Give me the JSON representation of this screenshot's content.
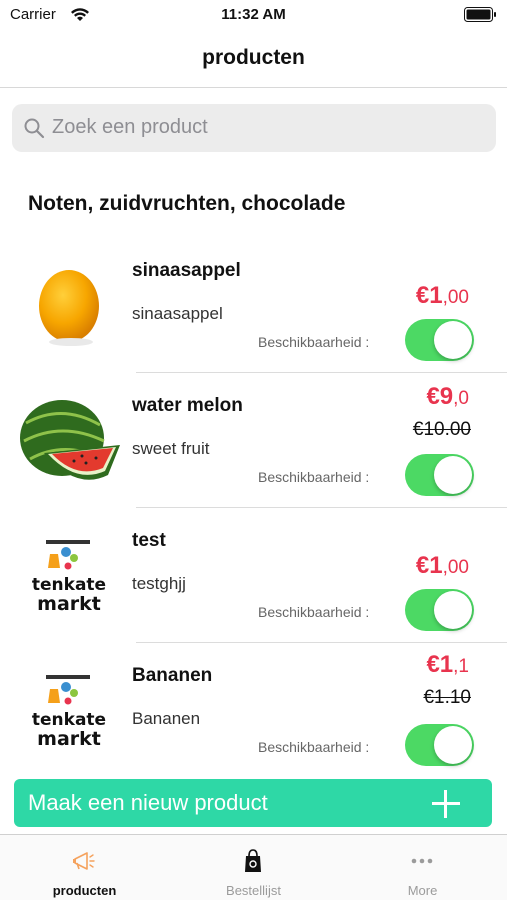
{
  "status_bar": {
    "carrier": "Carrier",
    "time": "11:32 AM"
  },
  "nav": {
    "title": "producten"
  },
  "search": {
    "placeholder": "Zoek een product"
  },
  "section": {
    "title": "Noten, zuidvruchten, chocolade"
  },
  "availability_label": "Beschikbaarheid :",
  "products": [
    {
      "name": "sinaasappel",
      "description": "sinaasappel",
      "price_euros": "€1",
      "price_cents": ",00",
      "old_price": "",
      "image": "orange-image",
      "available": true
    },
    {
      "name": "water melon",
      "description": "sweet fruit",
      "price_euros": "€9",
      "price_cents": ",0",
      "old_price": "€10.00",
      "image": "watermelon-image",
      "available": true
    },
    {
      "name": "test",
      "description": "testghjj",
      "price_euros": "€1",
      "price_cents": ",00",
      "old_price": "",
      "image": "tenkate-markt-logo",
      "available": true
    },
    {
      "name": "Bananen",
      "description": "Bananen",
      "price_euros": "€1",
      "price_cents": ",1",
      "old_price": "€1.10",
      "image": "tenkate-markt-logo",
      "available": true
    }
  ],
  "logo_text": {
    "line1": "tenkate",
    "line2": "markt"
  },
  "new_product_button": {
    "label": "Maak een nieuw product",
    "icon": "plus-icon"
  },
  "tabs": [
    {
      "label": "producten",
      "icon": "megaphone-icon",
      "active": true
    },
    {
      "label": "Bestellijst",
      "icon": "shopping-bag-icon",
      "active": false
    },
    {
      "label": "More",
      "icon": "more-dots-icon",
      "active": false
    }
  ],
  "colors": {
    "price": "#e8344e",
    "toggle_on": "#4cd964",
    "button": "#2ed8a6",
    "tab_active_icon": "#f5a25d"
  }
}
